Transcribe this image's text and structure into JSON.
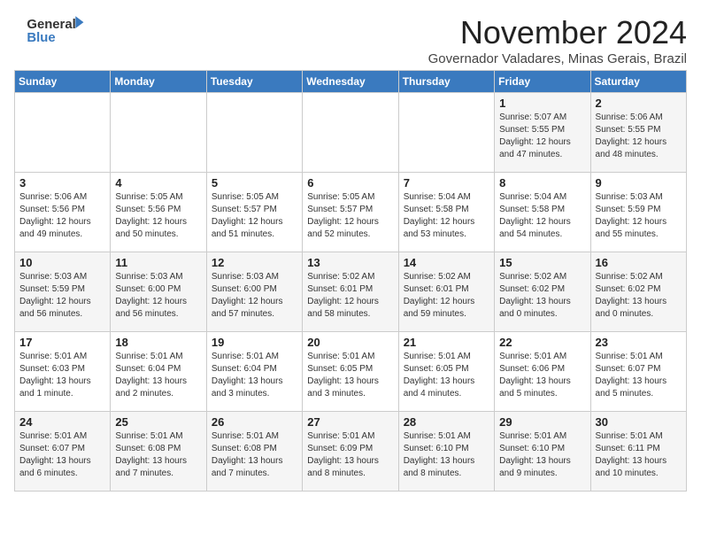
{
  "header": {
    "logo_general": "General",
    "logo_blue": "Blue",
    "month_year": "November 2024",
    "location": "Governador Valadares, Minas Gerais, Brazil"
  },
  "days_of_week": [
    "Sunday",
    "Monday",
    "Tuesday",
    "Wednesday",
    "Thursday",
    "Friday",
    "Saturday"
  ],
  "weeks": [
    [
      {
        "day": "",
        "info": ""
      },
      {
        "day": "",
        "info": ""
      },
      {
        "day": "",
        "info": ""
      },
      {
        "day": "",
        "info": ""
      },
      {
        "day": "",
        "info": ""
      },
      {
        "day": "1",
        "info": "Sunrise: 5:07 AM\nSunset: 5:55 PM\nDaylight: 12 hours\nand 47 minutes."
      },
      {
        "day": "2",
        "info": "Sunrise: 5:06 AM\nSunset: 5:55 PM\nDaylight: 12 hours\nand 48 minutes."
      }
    ],
    [
      {
        "day": "3",
        "info": "Sunrise: 5:06 AM\nSunset: 5:56 PM\nDaylight: 12 hours\nand 49 minutes."
      },
      {
        "day": "4",
        "info": "Sunrise: 5:05 AM\nSunset: 5:56 PM\nDaylight: 12 hours\nand 50 minutes."
      },
      {
        "day": "5",
        "info": "Sunrise: 5:05 AM\nSunset: 5:57 PM\nDaylight: 12 hours\nand 51 minutes."
      },
      {
        "day": "6",
        "info": "Sunrise: 5:05 AM\nSunset: 5:57 PM\nDaylight: 12 hours\nand 52 minutes."
      },
      {
        "day": "7",
        "info": "Sunrise: 5:04 AM\nSunset: 5:58 PM\nDaylight: 12 hours\nand 53 minutes."
      },
      {
        "day": "8",
        "info": "Sunrise: 5:04 AM\nSunset: 5:58 PM\nDaylight: 12 hours\nand 54 minutes."
      },
      {
        "day": "9",
        "info": "Sunrise: 5:03 AM\nSunset: 5:59 PM\nDaylight: 12 hours\nand 55 minutes."
      }
    ],
    [
      {
        "day": "10",
        "info": "Sunrise: 5:03 AM\nSunset: 5:59 PM\nDaylight: 12 hours\nand 56 minutes."
      },
      {
        "day": "11",
        "info": "Sunrise: 5:03 AM\nSunset: 6:00 PM\nDaylight: 12 hours\nand 56 minutes."
      },
      {
        "day": "12",
        "info": "Sunrise: 5:03 AM\nSunset: 6:00 PM\nDaylight: 12 hours\nand 57 minutes."
      },
      {
        "day": "13",
        "info": "Sunrise: 5:02 AM\nSunset: 6:01 PM\nDaylight: 12 hours\nand 58 minutes."
      },
      {
        "day": "14",
        "info": "Sunrise: 5:02 AM\nSunset: 6:01 PM\nDaylight: 12 hours\nand 59 minutes."
      },
      {
        "day": "15",
        "info": "Sunrise: 5:02 AM\nSunset: 6:02 PM\nDaylight: 13 hours\nand 0 minutes."
      },
      {
        "day": "16",
        "info": "Sunrise: 5:02 AM\nSunset: 6:02 PM\nDaylight: 13 hours\nand 0 minutes."
      }
    ],
    [
      {
        "day": "17",
        "info": "Sunrise: 5:01 AM\nSunset: 6:03 PM\nDaylight: 13 hours\nand 1 minute."
      },
      {
        "day": "18",
        "info": "Sunrise: 5:01 AM\nSunset: 6:04 PM\nDaylight: 13 hours\nand 2 minutes."
      },
      {
        "day": "19",
        "info": "Sunrise: 5:01 AM\nSunset: 6:04 PM\nDaylight: 13 hours\nand 3 minutes."
      },
      {
        "day": "20",
        "info": "Sunrise: 5:01 AM\nSunset: 6:05 PM\nDaylight: 13 hours\nand 3 minutes."
      },
      {
        "day": "21",
        "info": "Sunrise: 5:01 AM\nSunset: 6:05 PM\nDaylight: 13 hours\nand 4 minutes."
      },
      {
        "day": "22",
        "info": "Sunrise: 5:01 AM\nSunset: 6:06 PM\nDaylight: 13 hours\nand 5 minutes."
      },
      {
        "day": "23",
        "info": "Sunrise: 5:01 AM\nSunset: 6:07 PM\nDaylight: 13 hours\nand 5 minutes."
      }
    ],
    [
      {
        "day": "24",
        "info": "Sunrise: 5:01 AM\nSunset: 6:07 PM\nDaylight: 13 hours\nand 6 minutes."
      },
      {
        "day": "25",
        "info": "Sunrise: 5:01 AM\nSunset: 6:08 PM\nDaylight: 13 hours\nand 7 minutes."
      },
      {
        "day": "26",
        "info": "Sunrise: 5:01 AM\nSunset: 6:08 PM\nDaylight: 13 hours\nand 7 minutes."
      },
      {
        "day": "27",
        "info": "Sunrise: 5:01 AM\nSunset: 6:09 PM\nDaylight: 13 hours\nand 8 minutes."
      },
      {
        "day": "28",
        "info": "Sunrise: 5:01 AM\nSunset: 6:10 PM\nDaylight: 13 hours\nand 8 minutes."
      },
      {
        "day": "29",
        "info": "Sunrise: 5:01 AM\nSunset: 6:10 PM\nDaylight: 13 hours\nand 9 minutes."
      },
      {
        "day": "30",
        "info": "Sunrise: 5:01 AM\nSunset: 6:11 PM\nDaylight: 13 hours\nand 10 minutes."
      }
    ]
  ]
}
